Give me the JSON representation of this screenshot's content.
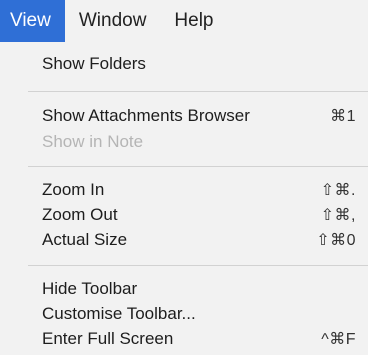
{
  "menubar": {
    "items": [
      {
        "label": "View"
      },
      {
        "label": "Window"
      },
      {
        "label": "Help"
      }
    ]
  },
  "menu": {
    "show_folders": "Show Folders",
    "show_attachments_browser": {
      "label": "Show Attachments Browser",
      "shortcut": "⌘1"
    },
    "show_in_note": "Show in Note",
    "zoom_in": {
      "label": "Zoom In",
      "shortcut": "⇧⌘."
    },
    "zoom_out": {
      "label": "Zoom Out",
      "shortcut": "⇧⌘,"
    },
    "actual_size": {
      "label": "Actual Size",
      "shortcut": "⇧⌘0"
    },
    "hide_toolbar": "Hide Toolbar",
    "customise_toolbar": "Customise Toolbar...",
    "enter_full_screen": {
      "label": "Enter Full Screen",
      "shortcut": "^⌘F"
    }
  },
  "colors": {
    "highlight": "#2f6fd6",
    "menu_bg": "#f2f2f2",
    "disabled_text": "#b5b5b5"
  }
}
